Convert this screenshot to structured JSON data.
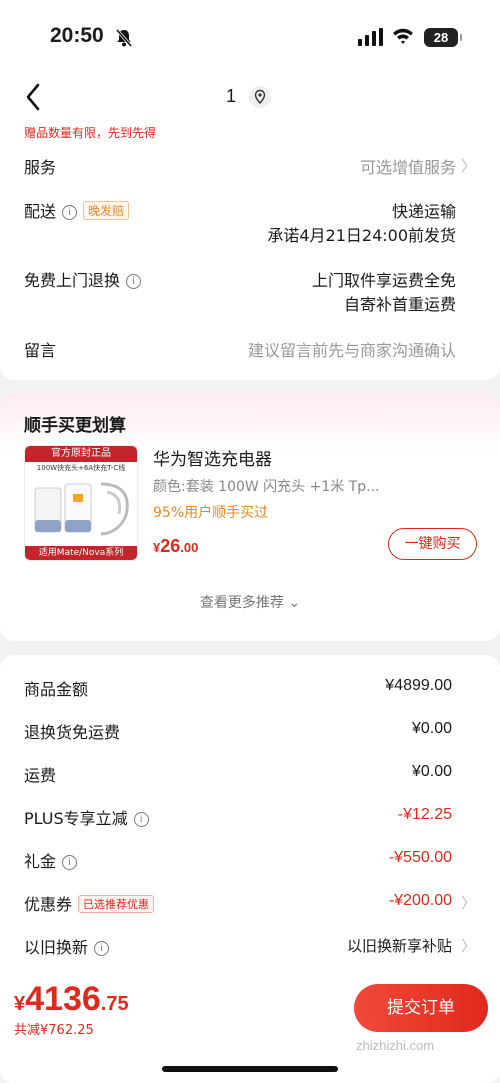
{
  "status_bar": {
    "time": "20:50",
    "battery": "28"
  },
  "nav": {
    "count": "1"
  },
  "order_info": {
    "gift_note": "赠品数量有限，先到先得",
    "service_label": "服务",
    "service_value": "可选增值服务",
    "delivery_label": "配送",
    "delivery_tag": "晚发赔",
    "delivery_value_1": "快递运输",
    "delivery_value_2": "承诺4月21日24:00前发货",
    "return_label": "免费上门退换",
    "return_value_1": "上门取件享运费全免",
    "return_value_2": "自寄补首重运费",
    "message_label": "留言",
    "message_placeholder": "建议留言前先与商家沟通确认"
  },
  "recommend": {
    "title": "顺手买更划算",
    "image_banner_top": "官方原封正品",
    "image_sub": "100W快充头+6A快充T-C线",
    "image_banner_bottom": "适用Mate/Nova系列",
    "product_name": "华为智选充电器",
    "product_spec": "颜色:套装 100W 闪充头 +1米 Tp...",
    "product_stat": "95%用户顺手买过",
    "price_currency": "¥",
    "price_int": "26",
    "price_dec": ".00",
    "buy_label": "一键购买",
    "more_label": "查看更多推荐"
  },
  "bill": {
    "rows": [
      {
        "label": "商品金额",
        "value": "¥4899.00"
      },
      {
        "label": "退换货免运费",
        "value": "¥0.00"
      },
      {
        "label": "运费",
        "value": "¥0.00"
      },
      {
        "label": "PLUS专享立减",
        "value": "-¥12.25"
      },
      {
        "label": "礼金",
        "value": "-¥550.00"
      },
      {
        "label": "优惠券",
        "tag": "已选推荐优惠",
        "value": "-¥200.00"
      },
      {
        "label": "以旧换新",
        "value": "以旧换新享补贴"
      }
    ]
  },
  "footer": {
    "currency": "¥",
    "total_int": "4136",
    "total_dec": ".75",
    "saved": "共减¥762.25",
    "submit_label": "提交订单",
    "watermark": "zhizhizhi.com"
  },
  "colors": {
    "accent": "#e0281c",
    "orange": "#e08a28",
    "background": "#f2f2f2"
  }
}
